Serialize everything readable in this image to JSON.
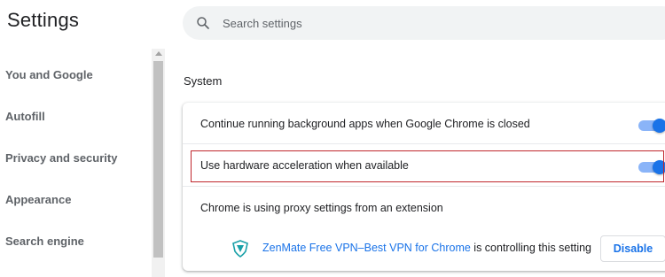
{
  "header": {
    "title": "Settings",
    "search_placeholder": "Search settings"
  },
  "sidebar": {
    "items": [
      {
        "label": "You and Google"
      },
      {
        "label": "Autofill"
      },
      {
        "label": "Privacy and security"
      },
      {
        "label": "Appearance"
      },
      {
        "label": "Search engine"
      }
    ]
  },
  "main": {
    "section_title": "System",
    "rows": {
      "background_apps": {
        "label": "Continue running background apps when Google Chrome is closed",
        "enabled": true
      },
      "hardware_acceleration": {
        "label": "Use hardware acceleration when available",
        "enabled": true
      },
      "proxy": {
        "label": "Chrome is using proxy settings from an extension"
      }
    },
    "extension": {
      "name": "ZenMate Free VPN–Best VPN for Chrome",
      "suffix": "is controlling this setting",
      "icon": "zenmate-shield-icon",
      "button_label": "Disable"
    }
  },
  "colors": {
    "accent": "#1a73e8",
    "toggle_track": "#8ab4f8",
    "highlight_border": "#c0272d"
  }
}
